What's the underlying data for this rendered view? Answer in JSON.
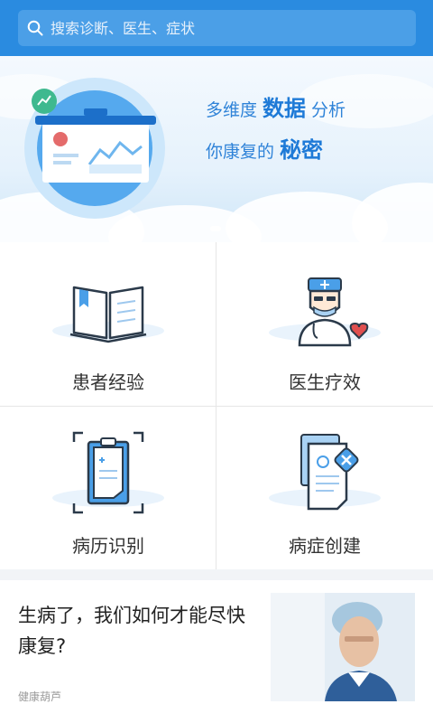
{
  "colors": {
    "primary": "#2a8be0",
    "search_bg": "#4b9fe7",
    "banner_text": "#2f83d8",
    "divider": "#e6e6e6"
  },
  "search": {
    "placeholder": "搜索诊断、医生、症状",
    "icon": "search-icon"
  },
  "banner": {
    "line1": {
      "prefix": "多维度",
      "highlight": "数据",
      "suffix": "分析"
    },
    "line2": {
      "prefix": "你康复的",
      "highlight": "秘密"
    },
    "illustration": "data-board-illustration"
  },
  "grid": {
    "items": [
      {
        "label": "患者经验",
        "icon": "open-book-icon"
      },
      {
        "label": "医生疗效",
        "icon": "doctor-icon"
      },
      {
        "label": "病历识别",
        "icon": "clipboard-scan-icon"
      },
      {
        "label": "病症创建",
        "icon": "document-create-icon"
      }
    ]
  },
  "article": {
    "title": "生病了，我们如何才能尽快康复?",
    "source": "健康葫芦",
    "image": "doctor-photo"
  }
}
